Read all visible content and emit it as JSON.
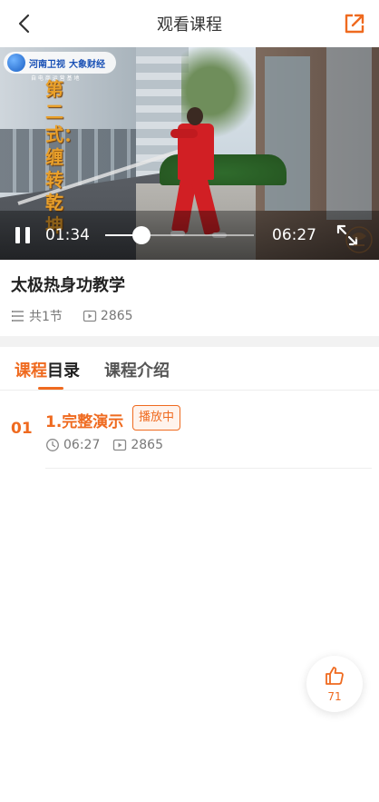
{
  "header": {
    "title": "观看课程",
    "back_icon": "chevron-left-icon",
    "share_icon": "share-external-icon"
  },
  "video": {
    "channel_name": "河南卫视",
    "channel_brand": "大象财经",
    "channel_sub": "自 电 商 运 营 基 地",
    "overlay_title": "第二式：缠转乾坤",
    "watermark": "国风太极",
    "current_time": "01:34",
    "total_time": "06:27",
    "progress": 0.243,
    "play_state_icon": "pause-icon",
    "fullscreen_icon": "fullscreen-expand-icon"
  },
  "course": {
    "title": "太极热身功教学",
    "lesson_count": "共1节",
    "view_count": "2865"
  },
  "tabs": {
    "catalog_highlight": "课程",
    "catalog_rest": "目录",
    "intro": "课程介绍"
  },
  "lessons": [
    {
      "number": "01",
      "title": "1.完整演示",
      "badge": "播放中",
      "duration": "06:27",
      "views": "2865"
    }
  ],
  "like": {
    "count": "71"
  },
  "colors": {
    "accent": "#ef6a1f",
    "text": "#222222",
    "muted": "#777777"
  }
}
